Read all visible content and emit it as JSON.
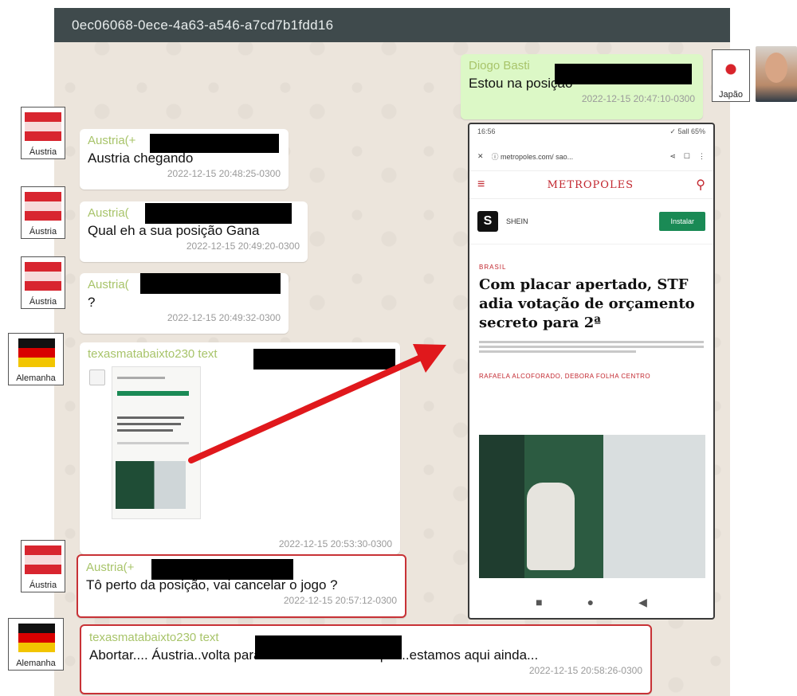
{
  "header": {
    "title": "0ec06068-0ece-4a63-a546-a7cd7b1fdd16"
  },
  "avatars": {
    "austria": "Áustria",
    "alemanha": "Alemanha",
    "japao": "Japão"
  },
  "messages": [
    {
      "sender": "Diogo Basti",
      "text": "Estou na posição",
      "ts": "2022-12-15 20:47:10-0300"
    },
    {
      "sender": "Austria(+",
      "text": "Austria chegando",
      "ts": "2022-12-15 20:48:25-0300"
    },
    {
      "sender": "Austria(",
      "text": "Qual eh a sua posição Gana",
      "ts": "2022-12-15 20:49:20-0300"
    },
    {
      "sender": "Austria(",
      "text": "?",
      "ts": "2022-12-15 20:49:32-0300"
    },
    {
      "sender": "texasmatabaixto230 text",
      "text": "",
      "ts": "2022-12-15 20:53:30-0300"
    },
    {
      "sender": "Austria(+",
      "text": "Tô perto da posição, vai cancelar o jogo ?",
      "ts": "2022-12-15 20:57:12-0300"
    },
    {
      "sender": "texasmatabaixto230 text",
      "text": "Abortar.... Áustria..volta para local de desembarque...estamos aqui ainda...",
      "ts": "2022-12-15 20:58:26-0300"
    }
  ],
  "phone": {
    "status_time": "16:56",
    "status_right": "✓ 5all 65%",
    "url": "ⓘ  metropoles.com/ sao...",
    "logo": "METROPOLES",
    "ad_name": "SHEIN",
    "ad_button": "Instalar",
    "category": "BRASIL",
    "headline": "Com placar apertado, STF\nadia votação de orçamento\nsecreto para 2ª",
    "author": "RAFAELA ALCOFORADO, DEBORA FOLHA CENTRO"
  },
  "colors": {
    "header_bg": "#3f4a4c",
    "highlight": "#c83236",
    "sender": "#a8c46a",
    "arrow": "#e0181c"
  }
}
